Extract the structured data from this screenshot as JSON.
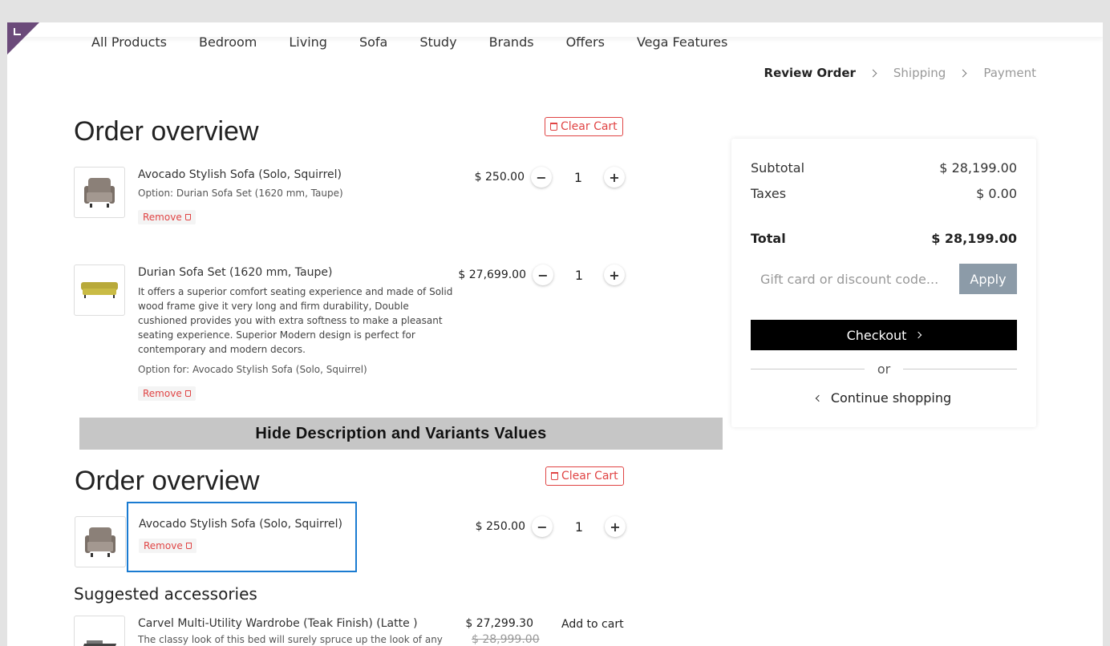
{
  "nav": {
    "items": [
      "All Products",
      "Bedroom",
      "Living",
      "Sofa",
      "Study",
      "Brands",
      "Offers",
      "Vega Features"
    ]
  },
  "steps": [
    "Review Order",
    "Shipping",
    "Payment"
  ],
  "cart_top": {
    "title": "Order overview",
    "clear_label": "Clear Cart",
    "items": [
      {
        "name": "Avocado Stylish Sofa (Solo, Squirrel)",
        "option": "Option: Durian Sofa Set (1620 mm, Taupe)",
        "remove": "Remove",
        "price": "$ 250.00",
        "qty": "1"
      },
      {
        "name": "Durian Sofa Set (1620 mm, Taupe)",
        "description": "It offers a superior comfort seating experience and made of Solid wood frame give it very long and firm durability, Double cushioned provides you with extra softness to make a pleasant seating experience. Superior Modern design is perfect for contemporary and modern decors.",
        "option": "Option for: Avocado Stylish Sofa (Solo, Squirrel)",
        "remove": "Remove",
        "price": "$ 27,699.00",
        "qty": "1"
      }
    ]
  },
  "banner": "Hide Description and Variants Values",
  "cart_bottom": {
    "title": "Order overview",
    "clear_label": "Clear Cart",
    "item": {
      "name": "Avocado Stylish Sofa (Solo, Squirrel)",
      "remove": "Remove",
      "price": "$ 250.00",
      "qty": "1"
    }
  },
  "accessories": {
    "title": "Suggested accessories",
    "item": {
      "name": "Carvel Multi-Utility Wardrobe (Teak Finish) (Latte )",
      "desc": "The classy look of this bed will surely spruce up the look of any",
      "price": "$ 27,299.30",
      "old_price": "$ 28,999.00",
      "add": "Add to cart"
    }
  },
  "summary": {
    "subtotal_label": "Subtotal",
    "subtotal": "$ 28,199.00",
    "taxes_label": "Taxes",
    "taxes": "$ 0.00",
    "total_label": "Total",
    "total": "$ 28,199.00",
    "promo_placeholder": "Gift card or discount code...",
    "apply": "Apply",
    "checkout": "Checkout",
    "or": "or",
    "continue": "Continue shopping"
  }
}
